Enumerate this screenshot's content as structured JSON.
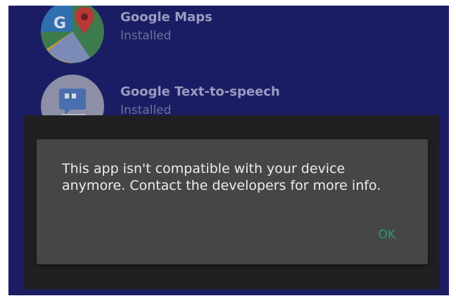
{
  "app_list": {
    "items": [
      {
        "name": "Google Maps",
        "status": "Installed",
        "icon": "google-maps-icon"
      },
      {
        "name": "Google Text-to-speech",
        "status": "Installed",
        "icon": "google-text-to-speech-icon"
      }
    ]
  },
  "dialog": {
    "message": "This app isn't compatible with your device anymore. Contact the developers for more info.",
    "ok_label": "OK"
  },
  "colors": {
    "background": "#1b1d64",
    "dialog": "#464646",
    "accent": "#2a9b7a"
  }
}
